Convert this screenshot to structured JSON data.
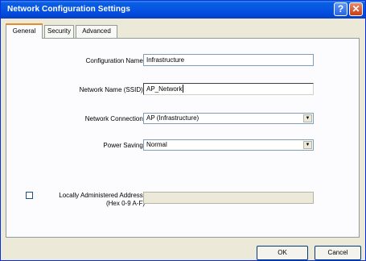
{
  "window": {
    "title": "Network Configuration Settings",
    "help_glyph": "?",
    "close_glyph": "✕"
  },
  "tabs": [
    {
      "label": "General",
      "active": true
    },
    {
      "label": "Security",
      "active": false
    },
    {
      "label": "Advanced",
      "active": false
    }
  ],
  "form": {
    "config_name_label": "Configuration Name:",
    "config_name_value": "Infrastructure",
    "ssid_label": "Network Name (SSID):",
    "ssid_value": "AP_Network",
    "connection_label": "Network Connection:",
    "connection_value": "AP (Infrastructure)",
    "power_label": "Power Saving:",
    "power_value": "Normal",
    "laa_label": "Locally Administered Address:",
    "laa_hint": "(Hex 0-9 A-F)",
    "laa_value": "",
    "laa_checked": false
  },
  "buttons": {
    "ok_label": "OK",
    "cancel_label": "Cancel"
  },
  "colors": {
    "titlebar": "#0554e3",
    "window_bg": "#ece9d8",
    "active_tab_accent": "#e68b2c"
  }
}
